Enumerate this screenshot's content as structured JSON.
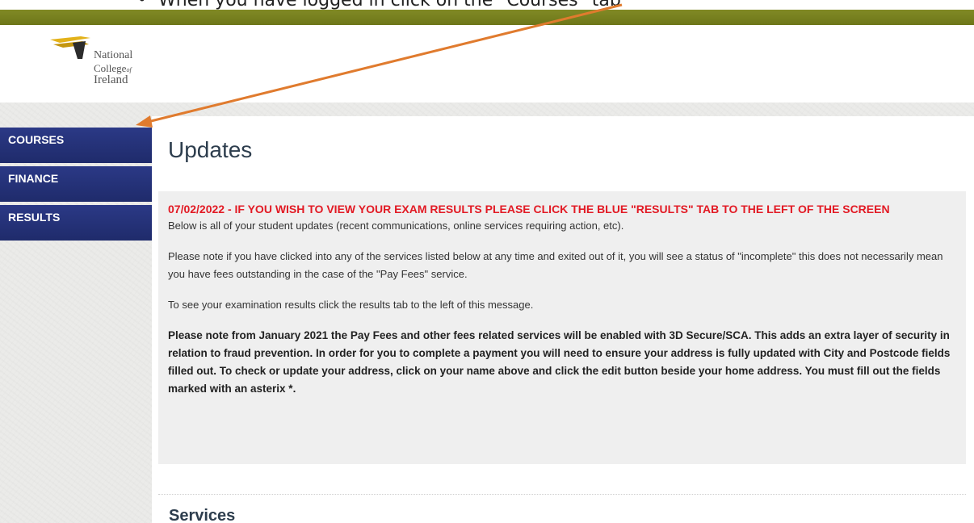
{
  "instruction": {
    "bullet": "•",
    "text": "When you have logged in click on the \"Courses\" tab"
  },
  "logo": {
    "line1": "National",
    "line2": "College",
    "line2_sub": "of",
    "line3": "Ireland"
  },
  "sidebar": {
    "items": [
      {
        "label": "COURSES"
      },
      {
        "label": "FINANCE"
      },
      {
        "label": "RESULTS"
      }
    ]
  },
  "main": {
    "title": "Updates",
    "alert": "07/02/2022 - IF YOU WISH TO VIEW YOUR EXAM RESULTS PLEASE CLICK THE BLUE \"RESULTS\" TAB TO THE LEFT OF THE SCREEN",
    "intro": "Below is all of your student updates (recent communications, online services requiring action, etc).",
    "note": "Please note if you have clicked into any of the services listed below at any time and exited out of it, you will see a status of \"incomplete\" this does not necessarily mean you have fees outstanding in the case of the \"Pay Fees\" service.",
    "results_note": "To see your examination results click the results tab to the left of this message.",
    "security_note": "Please note from January 2021 the Pay Fees and other fees related services will be enabled with 3D Secure/SCA. This adds an extra layer of security in relation to fraud prevention. In order for you to complete a payment you will need to ensure your address is fully updated with City and Postcode fields filled out. To check or update your address, click on your name above and click the edit button beside your home address. You must fill out the fields marked with an asterix *.",
    "services_title": "Services"
  },
  "colors": {
    "topbar": "#818a25",
    "nav": "#24307a",
    "alert": "#e21a24",
    "arrow": "#e07b2e"
  }
}
